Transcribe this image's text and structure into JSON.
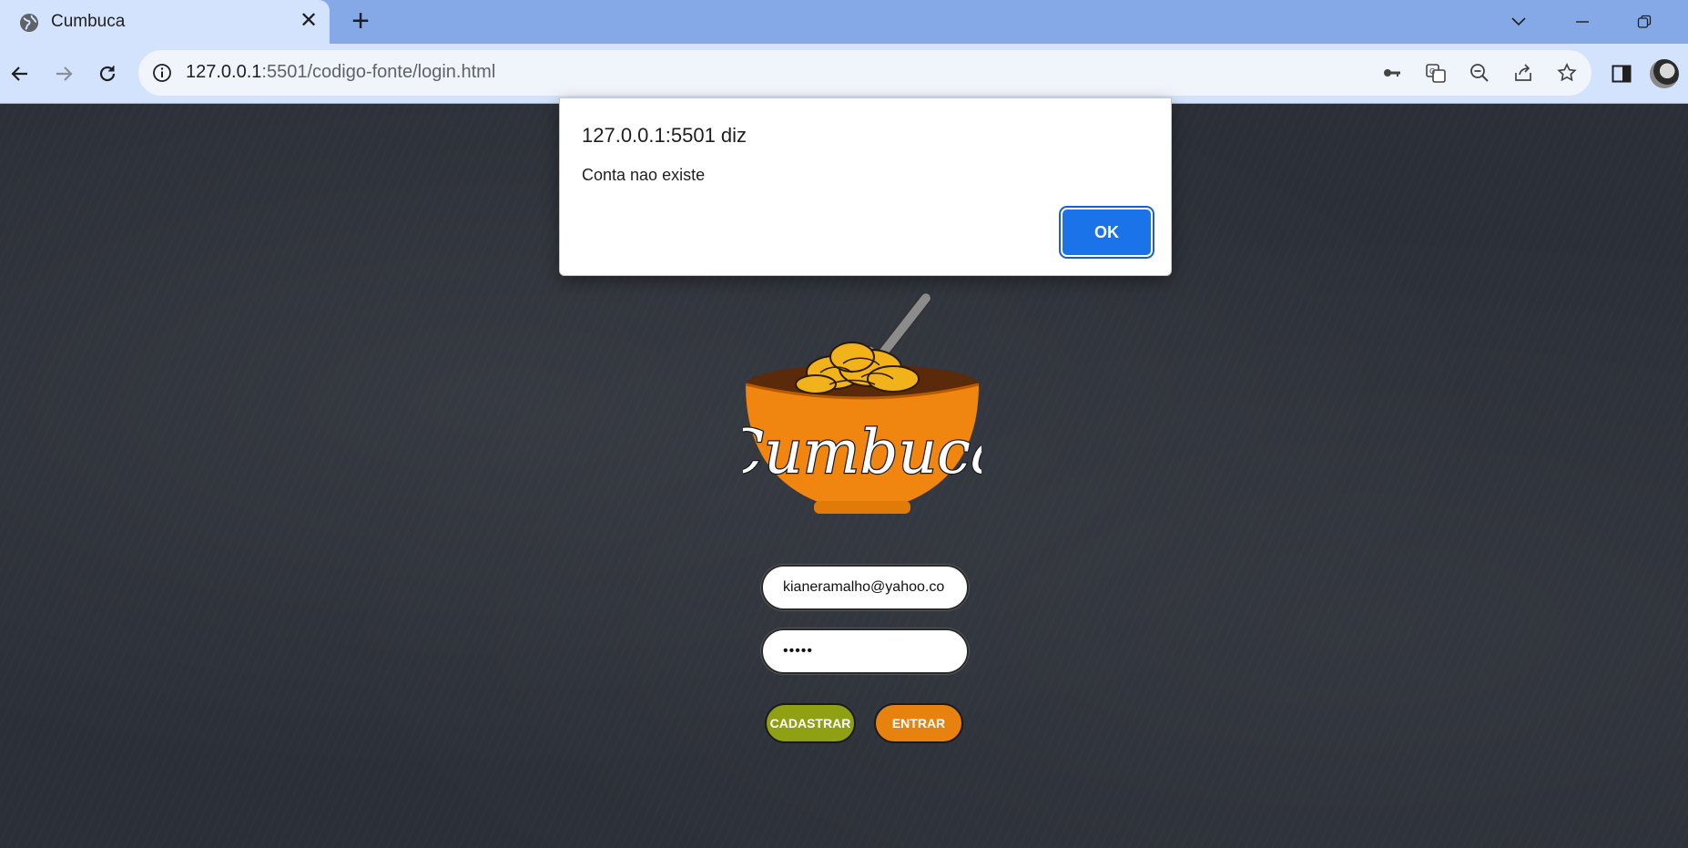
{
  "browser": {
    "tab": {
      "title": "Cumbuca",
      "close_glyph": "✕",
      "favicon": "globe-icon"
    },
    "new_tab_glyph": "+",
    "address": {
      "host": "127.0.0.1",
      "rest": ":5501/codigo-fonte/login.html"
    }
  },
  "dialog": {
    "title": "127.0.0.1:5501 diz",
    "message": "Conta nao existe",
    "ok_label": "OK"
  },
  "logo": {
    "text": "Cumbuca",
    "bowl_color": "#f0850f",
    "noodle_color": "#f2b21a"
  },
  "form": {
    "email_value": "kianeramalho@yahoo.co",
    "password_value": "•••••",
    "cadastrar_label": "CADASTRAR",
    "entrar_label": "ENTRAR"
  },
  "colors": {
    "cadastrar": "#8fa012",
    "entrar": "#e8820e",
    "ok": "#1a73e8",
    "tabbar": "#84a9e6"
  }
}
